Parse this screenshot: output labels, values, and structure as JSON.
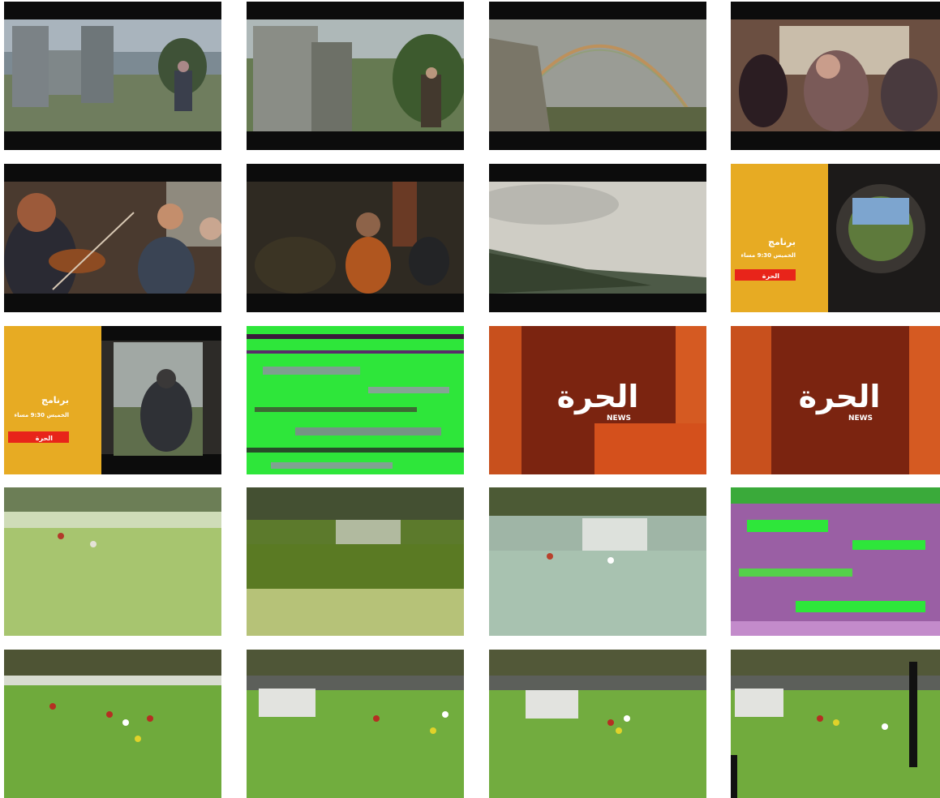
{
  "title": "",
  "thumbnails": [
    {
      "scene": "castle-tower-man-left"
    },
    {
      "scene": "castle-tower-man-right"
    },
    {
      "scene": "rainbow-over-ruin"
    },
    {
      "scene": "pub-crowd-blurred"
    },
    {
      "scene": "fiddle-players"
    },
    {
      "scene": "pub-laughing-woman"
    },
    {
      "scene": "cloudy-hills"
    },
    {
      "scene": "promo-window-hills",
      "promo_title": "برنامج",
      "promo_line": "الخميس 9:30 مساء",
      "promo_badge": "الحرة"
    },
    {
      "scene": "promo-man-at-window",
      "promo_title": "برنامج",
      "promo_line": "الخميس 9:30 مساء",
      "promo_badge": "الحرة"
    },
    {
      "scene": "digital-noise-green"
    },
    {
      "scene": "alhurra-logo-glitch",
      "logo_ar": "الحرة",
      "logo_en": "NEWS"
    },
    {
      "scene": "alhurra-logo",
      "logo_ar": "الحرة",
      "logo_en": "NEWS"
    },
    {
      "scene": "football-pitch-blurred"
    },
    {
      "scene": "football-goal-glitch"
    },
    {
      "scene": "football-goal-pixelated"
    },
    {
      "scene": "digital-noise-magenta"
    },
    {
      "scene": "football-players-midfield"
    },
    {
      "scene": "football-goal-wide"
    },
    {
      "scene": "football-goal-players"
    },
    {
      "scene": "football-glitch-bar"
    }
  ]
}
